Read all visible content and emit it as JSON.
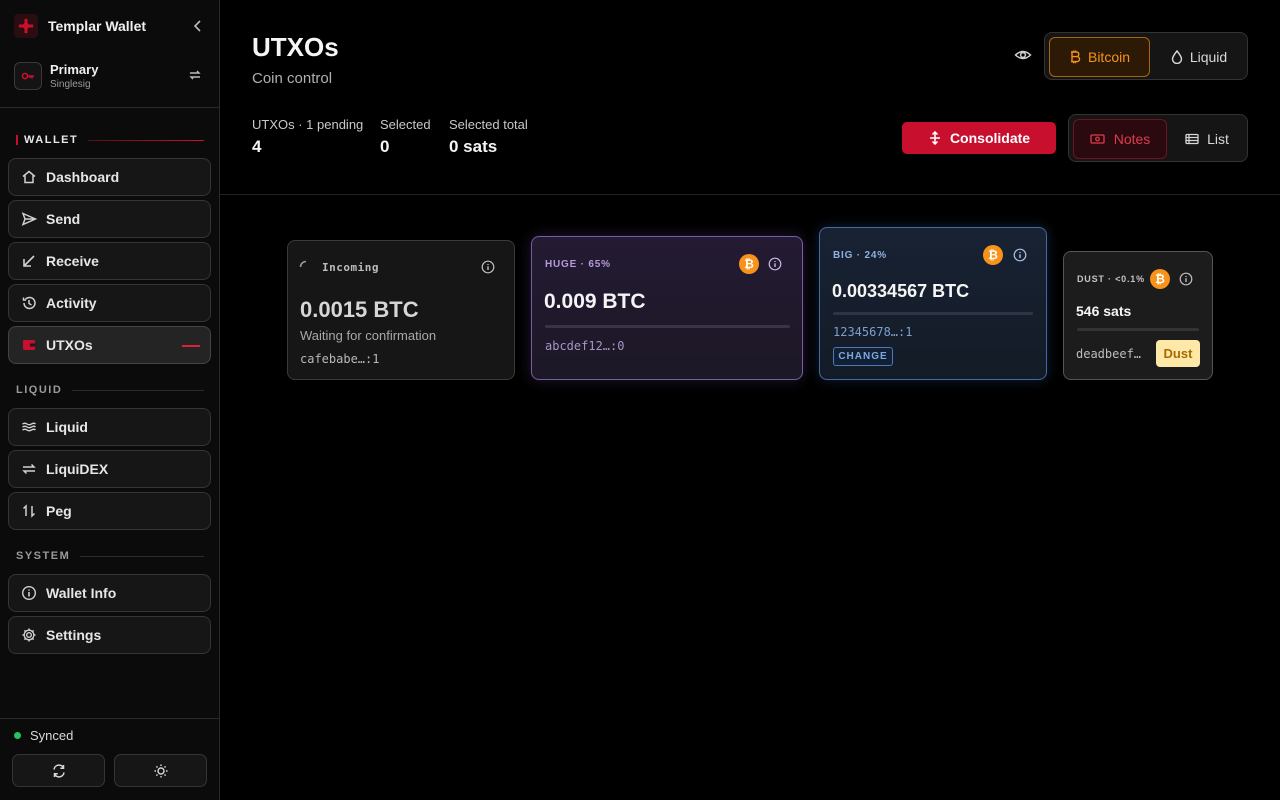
{
  "app": {
    "title": "Templar Wallet"
  },
  "wallet": {
    "name": "Primary",
    "type": "Singlesig"
  },
  "sidebar": {
    "sections": {
      "wallet": "WALLET",
      "liquid": "LIQUID",
      "system": "SYSTEM"
    },
    "items": {
      "dashboard": "Dashboard",
      "send": "Send",
      "receive": "Receive",
      "activity": "Activity",
      "utxos": "UTXOs",
      "liquid": "Liquid",
      "liquidex": "LiquiDEX",
      "peg": "Peg",
      "wallet_info": "Wallet Info",
      "settings": "Settings"
    },
    "status": "Synced"
  },
  "page": {
    "title": "UTXOs",
    "subtitle": "Coin control"
  },
  "network_toggle": {
    "bitcoin": "Bitcoin",
    "liquid": "Liquid",
    "selected": "Bitcoin"
  },
  "stats": [
    {
      "label": "UTXOs · 1 pending",
      "value": "4"
    },
    {
      "label": "Selected",
      "value": "0"
    },
    {
      "label": "Selected total",
      "value": "0 sats"
    }
  ],
  "actions": {
    "consolidate": "Consolidate"
  },
  "view_toggle": {
    "notes": "Notes",
    "list": "List",
    "selected": "Notes"
  },
  "utxos": [
    {
      "tag": "Incoming",
      "amount": "0.0015 BTC",
      "status": "Waiting for confirmation",
      "outpoint": "cafebabe…:1"
    },
    {
      "tag": "HUGE · 65%",
      "amount": "0.009 BTC",
      "outpoint": "abcdef12…:0",
      "coin_symbol": "₿",
      "share": 0.65
    },
    {
      "tag": "BIG · 24%",
      "amount": "0.00334567 BTC",
      "outpoint": "12345678…:1",
      "badge": "CHANGE",
      "coin_symbol": "₿",
      "share": 0.24
    },
    {
      "tag": "DUST · <0.1%",
      "amount": "546 sats",
      "outpoint": "deadbeef…",
      "badge": "Dust",
      "coin_symbol": "₿",
      "share": 0.001
    }
  ],
  "colors": {
    "accent": "#c8102e",
    "bitcoin": "#f7931a",
    "synced": "#22c55e",
    "huge": "#7a5ba8",
    "big": "#3f6aa8"
  }
}
